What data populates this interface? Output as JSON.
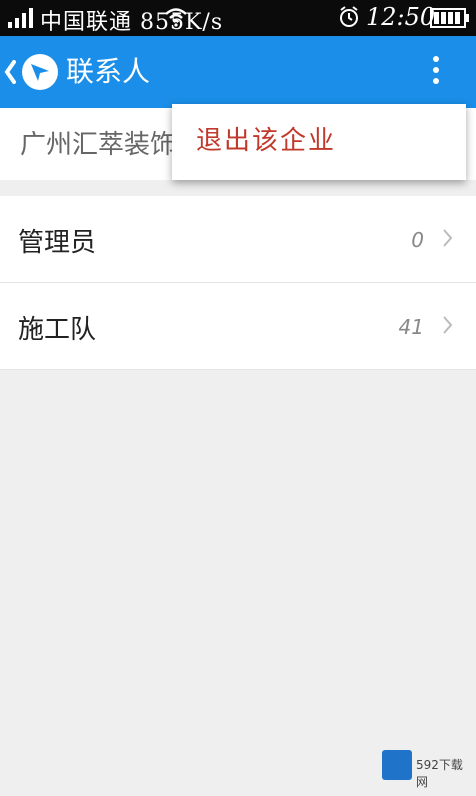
{
  "status_bar": {
    "carrier": "中国联通 855K/s",
    "time": "12:50"
  },
  "action_bar": {
    "title": "联系人"
  },
  "company": {
    "name": "广州汇萃装饰"
  },
  "groups": [
    {
      "label": "管理员",
      "count": "0"
    },
    {
      "label": "施工队",
      "count": "41"
    }
  ],
  "popup_menu": {
    "items": [
      {
        "label": "退出该企业"
      }
    ]
  },
  "watermark": {
    "text": "592下载网"
  },
  "colors": {
    "action_bar": "#1a8ee8",
    "status_bar": "#0b0b0b",
    "background": "#efefef",
    "menu_text": "#c0392b"
  }
}
